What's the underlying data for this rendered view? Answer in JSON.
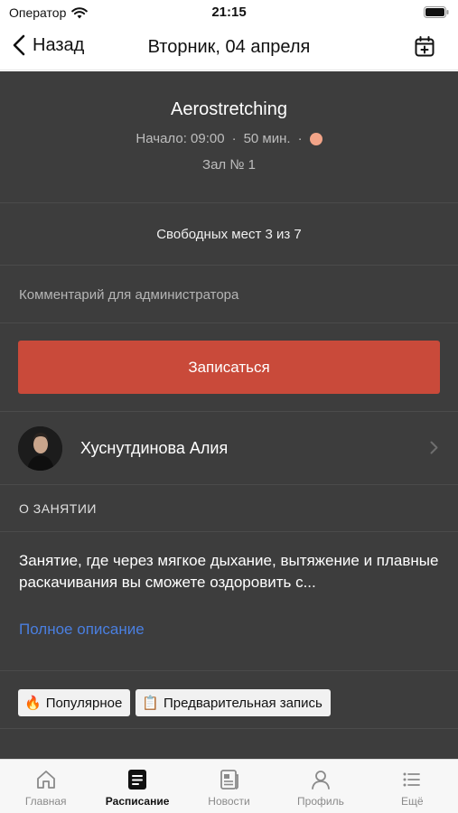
{
  "status_bar": {
    "carrier": "Оператор",
    "time": "21:15"
  },
  "nav": {
    "back_label": "Назад",
    "title": "Вторник, 04 апреля"
  },
  "class": {
    "title": "Aerostretching",
    "start": "Начало: 09:00",
    "duration": "50 мин.",
    "separator": "·",
    "intensity_color": "#f2a488",
    "room": "Зал № 1"
  },
  "seats": {
    "text": "Свободных мест 3 из 7"
  },
  "comment": {
    "placeholder": "Комментарий для администратора",
    "value": ""
  },
  "signup_button": {
    "label": "Записаться",
    "color": "#c94a3a"
  },
  "trainer": {
    "name": "Хуснутдинова Алия"
  },
  "about": {
    "section_label": "О ЗАНЯТИИ",
    "text": "Занятие, где через мягкое дыхание, вытяжение и плавные раскачивания вы сможете оздоровить с...",
    "more_link": "Полное описание",
    "link_color": "#4a7fe0"
  },
  "tags": [
    {
      "emoji": "🔥",
      "icon": "fire-icon",
      "label": "Популярное"
    },
    {
      "emoji": "📋",
      "icon": "clipboard-icon",
      "label": "Предварительная запись"
    }
  ],
  "tabbar": {
    "items": [
      {
        "label": "Главная",
        "icon": "home-icon",
        "active": false
      },
      {
        "label": "Расписание",
        "icon": "schedule-icon",
        "active": true
      },
      {
        "label": "Новости",
        "icon": "news-icon",
        "active": false
      },
      {
        "label": "Профиль",
        "icon": "profile-icon",
        "active": false
      },
      {
        "label": "Ещё",
        "icon": "more-icon",
        "active": false
      }
    ]
  }
}
